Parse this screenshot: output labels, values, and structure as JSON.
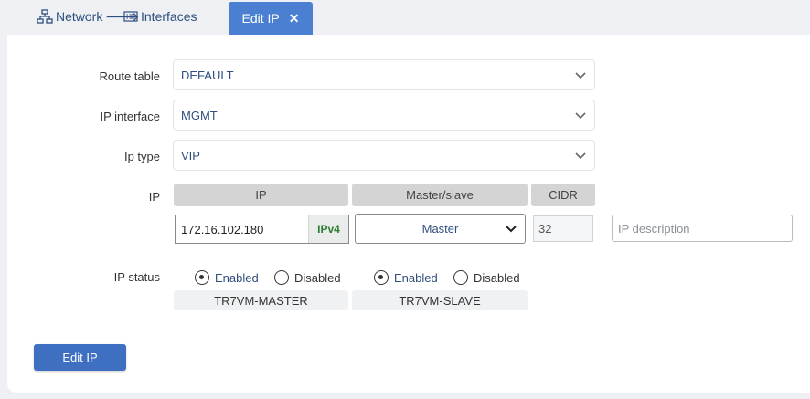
{
  "breadcrumb": {
    "network": "Network",
    "separator": "🡒",
    "interfaces": "Interfaces"
  },
  "tab": {
    "label": "Edit IP",
    "close": "✕"
  },
  "form": {
    "route_table": {
      "label": "Route table",
      "value": "DEFAULT"
    },
    "ip_interface": {
      "label": "IP interface",
      "value": "MGMT"
    },
    "ip_type": {
      "label": "Ip type",
      "value": "VIP"
    },
    "ip_row": {
      "label": "IP",
      "headers": [
        "IP",
        "Master/slave",
        "CIDR"
      ],
      "ip_value": "172.16.102.180",
      "ip_version": "IPv4",
      "master_slave": "Master",
      "cidr": "32",
      "description_placeholder": "IP description"
    },
    "ip_status": {
      "label": "IP status",
      "nodes": [
        {
          "name": "TR7VM-MASTER",
          "enabled_label": "Enabled",
          "disabled_label": "Disabled",
          "selected": "enabled"
        },
        {
          "name": "TR7VM-SLAVE",
          "enabled_label": "Enabled",
          "disabled_label": "Disabled",
          "selected": "enabled"
        }
      ]
    },
    "submit_label": "Edit IP"
  },
  "colors": {
    "accent": "#4a7fd1",
    "button": "#3e6fc0",
    "link": "#2f4f7f",
    "ipv4": "#2e7d32"
  }
}
